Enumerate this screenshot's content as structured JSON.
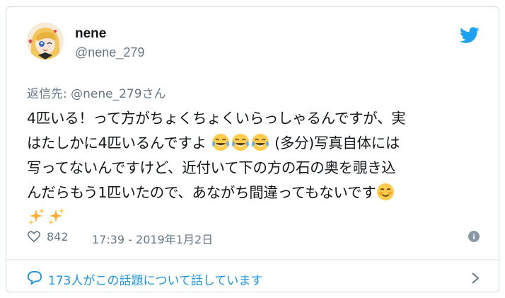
{
  "user": {
    "display_name": "nene",
    "handle": "@nene_279"
  },
  "reply_to": {
    "prefix": "返信先: ",
    "handle": "@nene_279",
    "suffix": "さん"
  },
  "tweet": {
    "line1": "4匹いる！って方がちょくちょくいらっしゃるんですが、実",
    "line2a": "はたしかに4匹いるんですよ",
    "line2b": " (多分)写真自体には",
    "line3": "写ってないんですけど、近付いて下の方の石の奥を覗き込",
    "line4": "んだらもう1匹いたので、あながち間違ってもないです"
  },
  "emoji": {
    "tears_of_joy": "face-with-tears-of-joy-icon",
    "smiling_blush": "smiling-face-icon",
    "sparkles": "sparkles-icon"
  },
  "meta": {
    "like_count": "842",
    "timestamp": "17:39 - 2019年1月2日"
  },
  "footer": {
    "conversation_text": "173人がこの話題について話しています"
  },
  "colors": {
    "accent": "#1da1f2",
    "link": "#1b95e0",
    "secondary_text": "#657786",
    "border": "#d2dbe2"
  }
}
